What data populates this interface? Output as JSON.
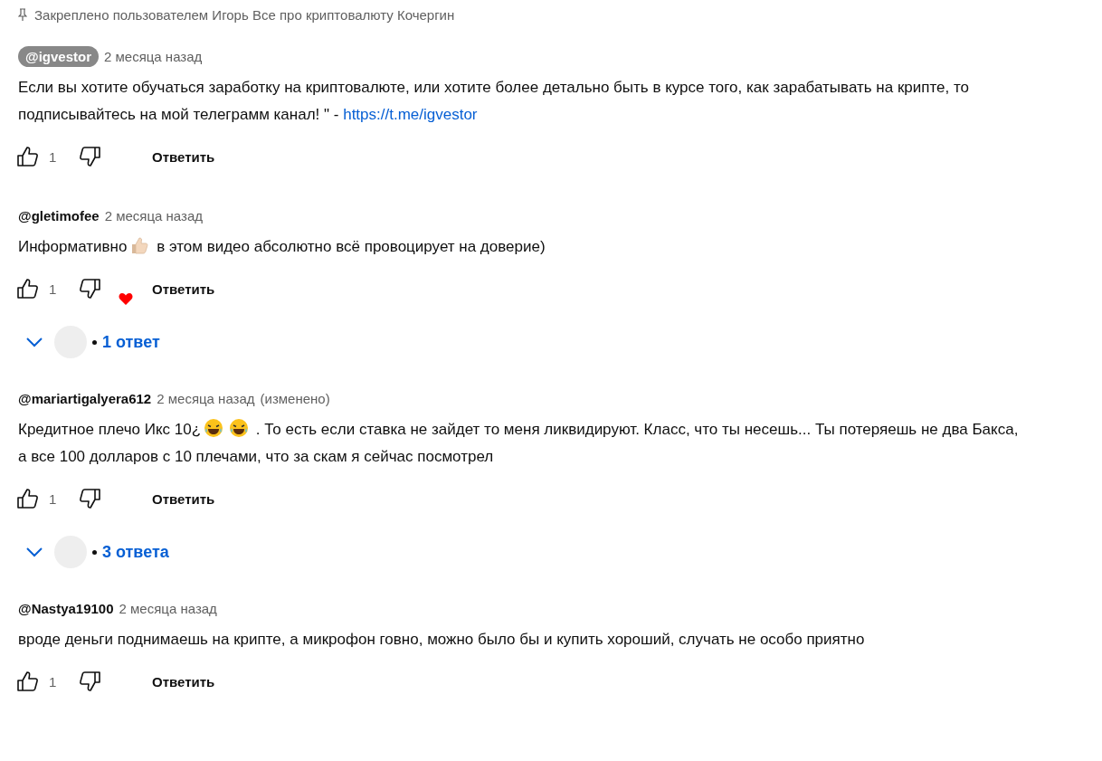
{
  "pinned": {
    "label": "Закреплено пользователем Игорь Все про криптовалюту Кочергин"
  },
  "comments": [
    {
      "author": "@igvestor",
      "owner": true,
      "time": "2 месяца назад",
      "body": [
        {
          "kind": "text",
          "text": "Если вы хотите обучаться заработку на криптовалюте, или хотите более детально быть в курсе того, как зарабатывать на крипте, то подписывайтесь на мой телеграмм канал! \" - "
        },
        {
          "kind": "link",
          "text": "https://t.me/igvestor"
        }
      ],
      "likes": "1",
      "reply_label": "Ответить",
      "hearted": false
    },
    {
      "author": "@gletimofee",
      "owner": false,
      "time": "2 месяца назад",
      "body": [
        {
          "kind": "text",
          "text": "Информативно"
        },
        {
          "kind": "thumb"
        },
        {
          "kind": "text",
          "text": " в этом видео абсолютно всё провоцирует на доверие)"
        }
      ],
      "likes": "1",
      "reply_label": "Ответить",
      "hearted": true,
      "replies": "1 ответ"
    },
    {
      "author": "@mariartigalyera612",
      "owner": false,
      "time": "2 месяца назад",
      "edited": "(изменено)",
      "body": [
        {
          "kind": "text",
          "text": "Кредитное плечо Икс 10¿"
        },
        {
          "kind": "laugh"
        },
        {
          "kind": "laugh"
        },
        {
          "kind": "text",
          "text": " . То есть если ставка не зайдет то меня ликвидируют. Класс, что ты несешь... Ты потеряешь не два Бакса, а все 100 долларов с 10 плечами, что за скам я сейчас посмотрел"
        }
      ],
      "likes": "1",
      "reply_label": "Ответить",
      "hearted": false,
      "replies": "3 ответа"
    },
    {
      "author": "@Nastya19100",
      "owner": false,
      "time": "2 месяца назад",
      "body": [
        {
          "kind": "text",
          "text": "вроде деньги поднимаешь на крипте, а микрофон говно, можно было бы и купить хороший, случать не особо приятно"
        }
      ],
      "likes": "1",
      "reply_label": "Ответить",
      "hearted": false
    }
  ]
}
